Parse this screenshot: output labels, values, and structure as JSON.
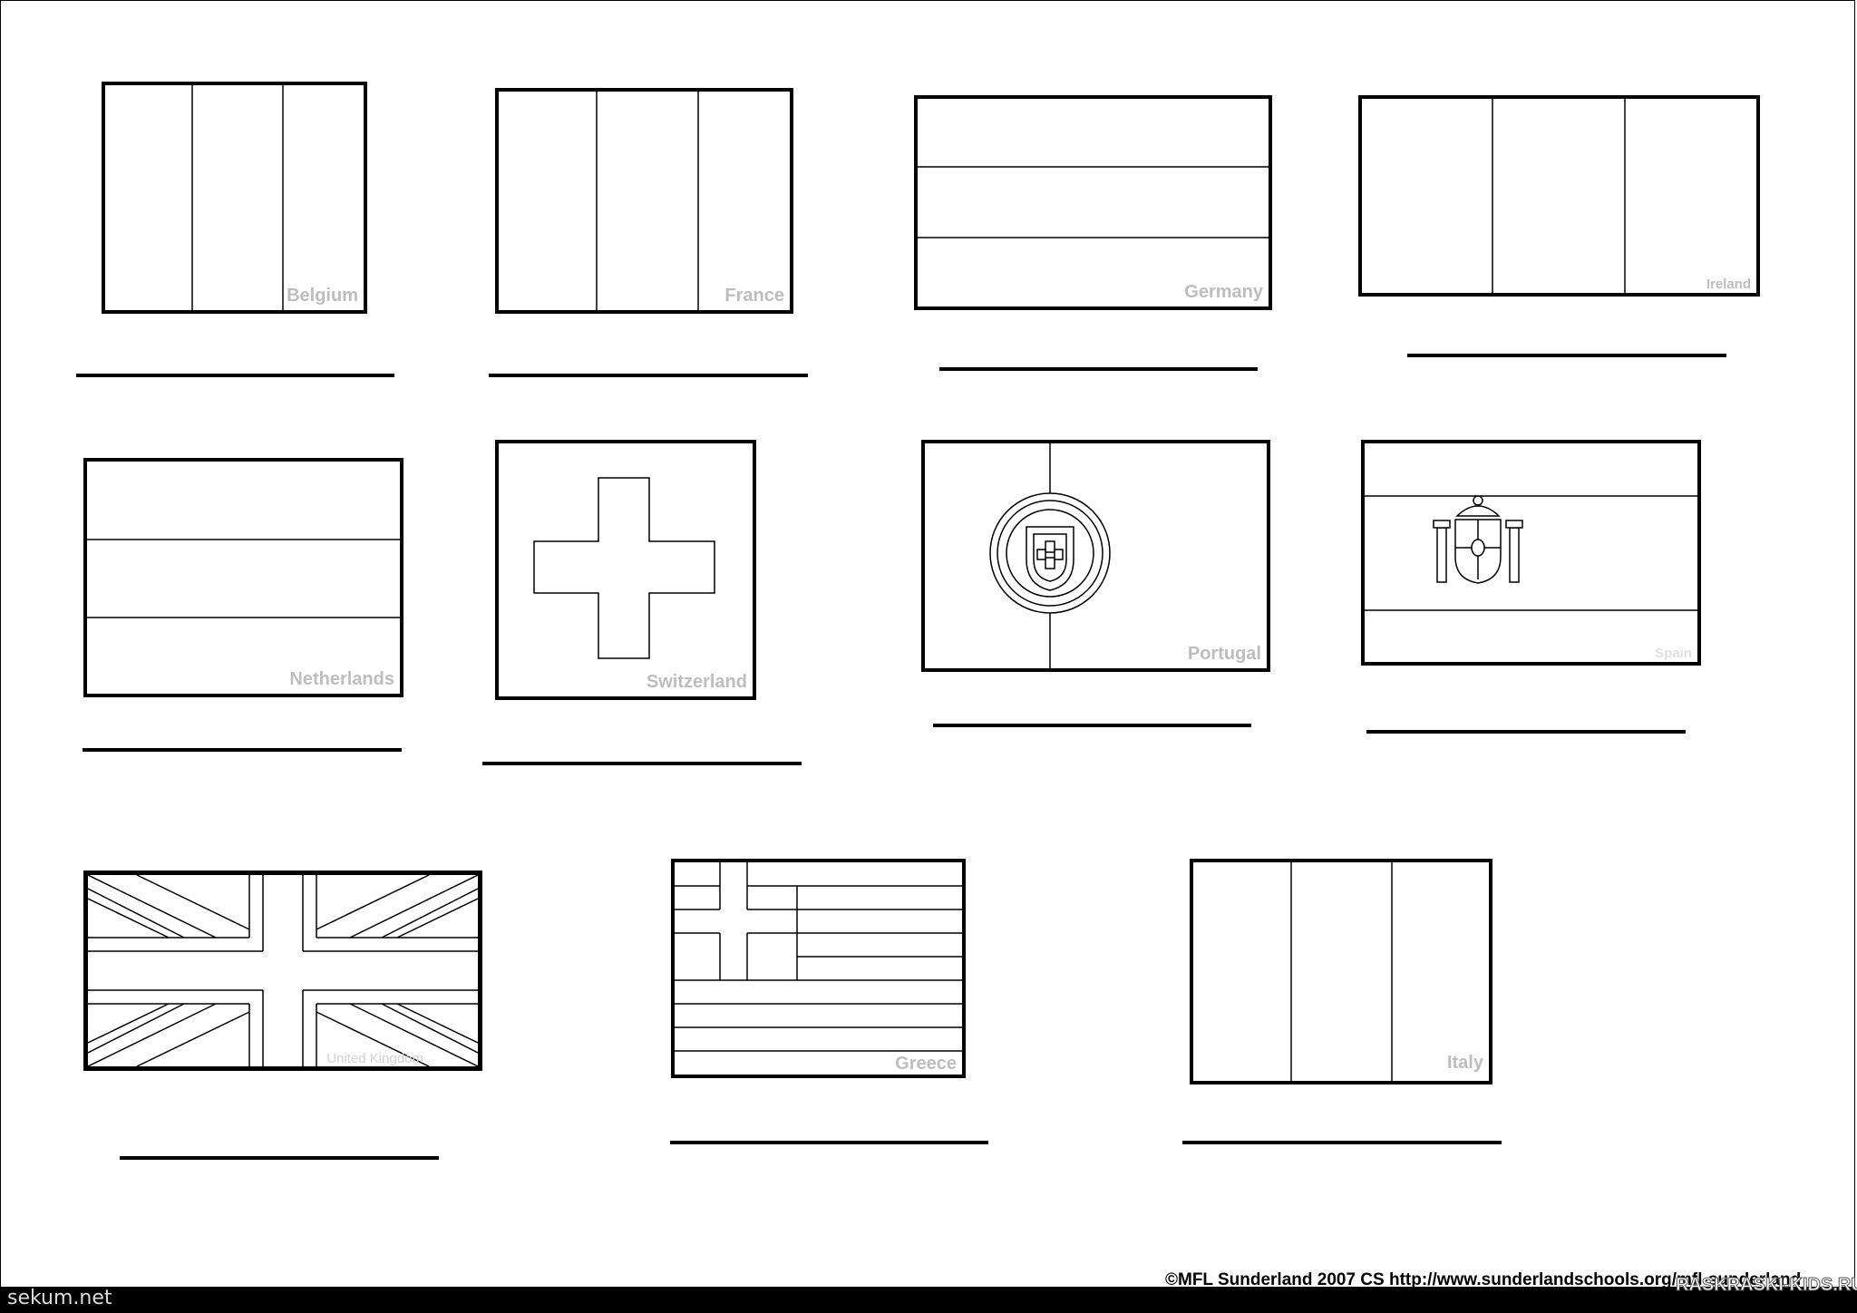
{
  "flags": [
    {
      "name": "Belgium"
    },
    {
      "name": "France"
    },
    {
      "name": "Germany"
    },
    {
      "name": "Ireland"
    },
    {
      "name": "Netherlands"
    },
    {
      "name": "Switzerland"
    },
    {
      "name": "Portugal"
    },
    {
      "name": "Spain"
    },
    {
      "name": "United Kingdom"
    },
    {
      "name": "Greece"
    },
    {
      "name": "Italy"
    }
  ],
  "footer": {
    "credit": "©MFL Sunderland 2007 CS http://www.sunderlandschools.org/mfl-sunderland",
    "site": "sekum.net",
    "watermark": "RASKRASKI-KIDS.RU"
  },
  "colors": {
    "outline": "#000000",
    "label": "#bdbdbd",
    "background": "#ffffff"
  }
}
